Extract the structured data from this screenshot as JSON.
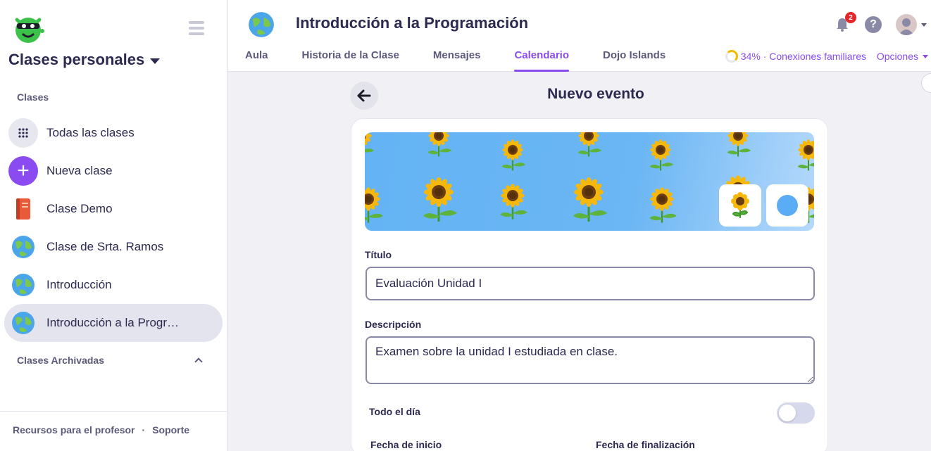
{
  "sidebar": {
    "switcher_title": "Clases personales",
    "section_label": "Clases",
    "items": [
      {
        "label": "Todas las clases",
        "icon": "grid-icon"
      },
      {
        "label": "Nueva clase",
        "icon": "plus-icon"
      },
      {
        "label": "Clase Demo",
        "icon": "book-icon"
      },
      {
        "label": "Clase de Srta. Ramos",
        "icon": "globe-icon"
      },
      {
        "label": "Introducción",
        "icon": "globe-icon"
      },
      {
        "label": "Introducción a la Programación",
        "icon": "globe-icon",
        "active": true
      }
    ],
    "archived_label": "Clases Archivadas",
    "footer": {
      "resources": "Recursos para el profesor",
      "separator": "·",
      "support": "Soporte"
    }
  },
  "header": {
    "class_title": "Introducción a la Programación",
    "tabs": [
      "Aula",
      "Historia de la Clase",
      "Mensajes",
      "Calendario",
      "Dojo Islands"
    ],
    "active_tab": "Calendario",
    "notification_count": "2",
    "help_symbol": "?",
    "connections_label": "34% · Conexiones familiares",
    "options_label": "Opciones"
  },
  "form": {
    "page_title": "Nuevo evento",
    "title_label": "Título",
    "title_value": "Evaluación Unidad I",
    "description_label": "Descripción",
    "description_value": "Examen sobre la unidad I estudiada en clase.",
    "all_day_label": "Todo el día",
    "all_day_on": false,
    "start_label": "Fecha de inicio",
    "end_label": "Fecha de finalización",
    "selected_color": "#5aacf4"
  },
  "colors": {
    "accent": "#8a4cf0",
    "text": "#2c2a50",
    "banner": "#64b3f4"
  }
}
